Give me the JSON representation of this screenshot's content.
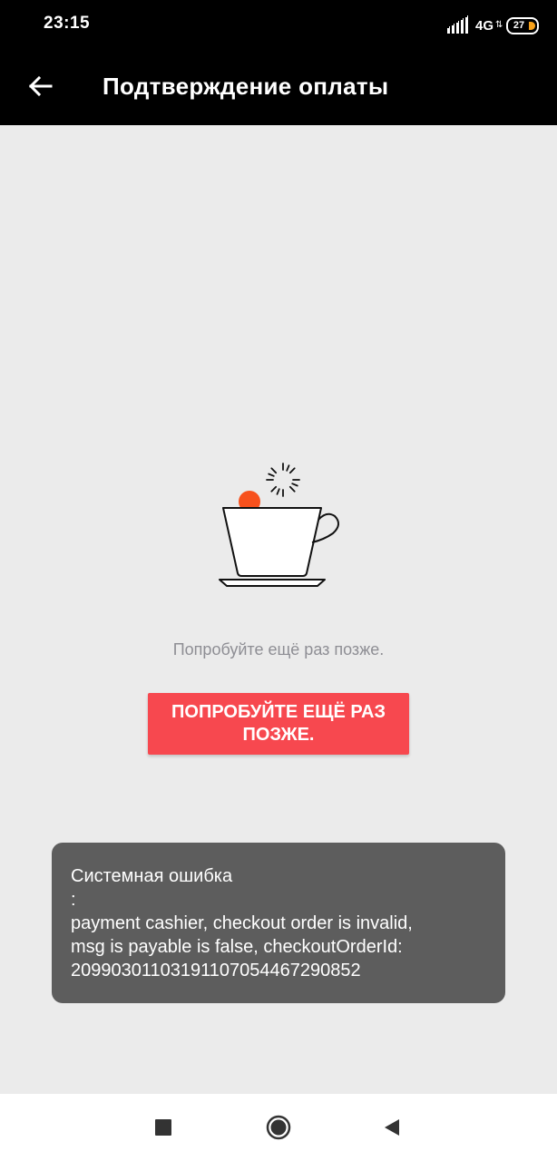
{
  "status_bar": {
    "time": "23:15",
    "network": "4G",
    "battery": "27",
    "colors": {
      "battery_fill": "#f7a11a"
    }
  },
  "app_bar": {
    "title": "Подтверждение оплаты",
    "back_icon": "arrow-left-icon"
  },
  "main": {
    "illustration": "coffee-cup-icon",
    "hint": "Попробуйте ещё раз позже.",
    "retry_button": {
      "line1": "ПОПРОБУЙТЕ ЕЩЁ РАЗ",
      "line2": "ПОЗЖЕ."
    }
  },
  "toast": {
    "title": "Системная ошибка",
    "colon": ":",
    "line1": "payment cashier, checkout order is invalid,",
    "line2": "msg is  payable is false, checkoutOrderId:",
    "line3": "20990301103191107054467290852"
  },
  "nav_bar": {
    "recents_icon": "square-icon",
    "home_icon": "circle-icon",
    "back_icon": "triangle-back-icon"
  },
  "colors": {
    "accent": "#f7484f",
    "toast_bg": "#5d5d5d",
    "page_bg": "#ebebeb"
  }
}
